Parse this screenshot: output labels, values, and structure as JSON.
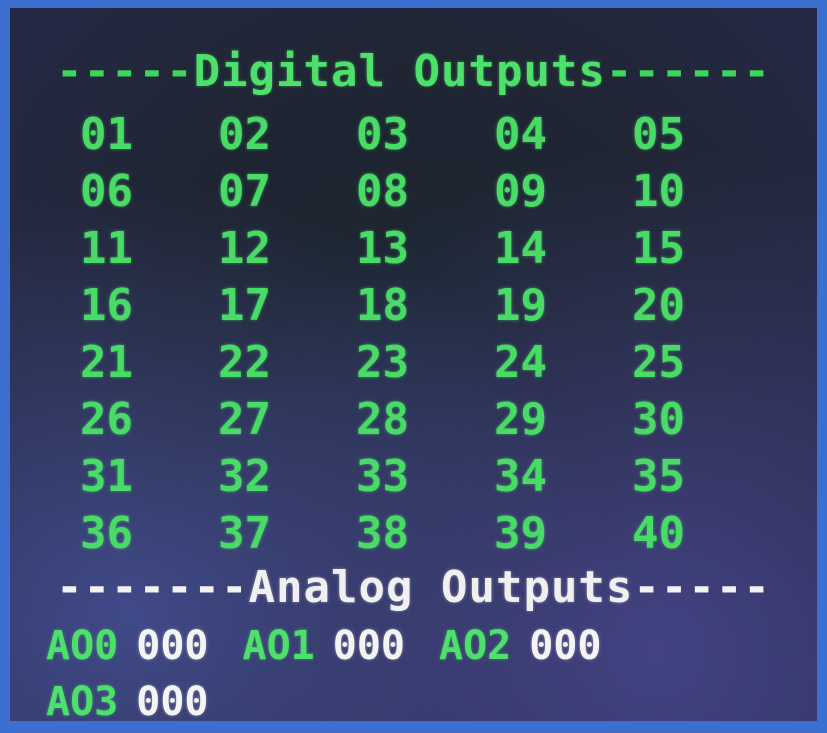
{
  "digital_section": {
    "left_dashes": "-----",
    "title": "Digital Outputs",
    "right_dashes": "------"
  },
  "digital_outputs": [
    "01",
    "02",
    "03",
    "04",
    "05",
    "06",
    "07",
    "08",
    "09",
    "10",
    "11",
    "12",
    "13",
    "14",
    "15",
    "16",
    "17",
    "18",
    "19",
    "20",
    "21",
    "22",
    "23",
    "24",
    "25",
    "26",
    "27",
    "28",
    "29",
    "30",
    "31",
    "32",
    "33",
    "34",
    "35",
    "36",
    "37",
    "38",
    "39",
    "40"
  ],
  "analog_section": {
    "left_dashes": "-------",
    "title": "Analog Outputs",
    "right_dashes": "-----"
  },
  "analog_outputs": [
    {
      "label": "AO0",
      "value": "000"
    },
    {
      "label": "AO1",
      "value": "000"
    },
    {
      "label": "AO2",
      "value": "000"
    },
    {
      "label": "AO3",
      "value": "000"
    }
  ],
  "colors": {
    "frame": "#3b6fd0",
    "green_text": "#48db66",
    "white_text": "#f2f2f2"
  }
}
